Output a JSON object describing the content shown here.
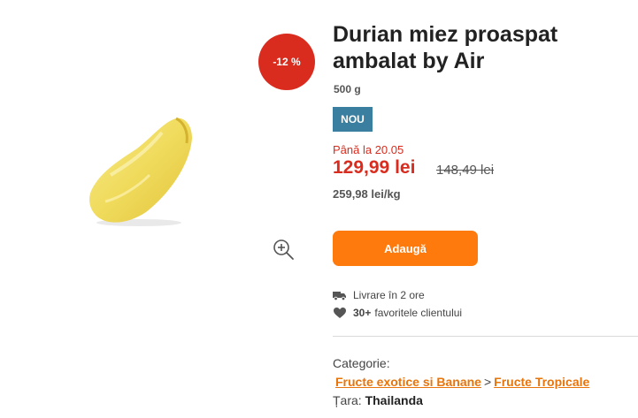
{
  "product": {
    "title": "Durian miez proaspat ambalat by Air",
    "weight": "500 g",
    "discount_badge": "-12 %",
    "new_badge": "NOU",
    "promo_until": "Până la 20.05",
    "price": "129,99 lei",
    "old_price": "148,49 lei",
    "unit_price": "259,98 lei/kg",
    "add_button_label": "Adaugă"
  },
  "features": {
    "delivery": "Livrare în 2 ore",
    "favorites_count": "30+",
    "favorites_text": "favoritele clientului"
  },
  "details": {
    "category_label": "Categorie:",
    "category_path": [
      "Fructe exotice si Banane",
      "Fructe Tropicale"
    ],
    "category_separator": ">",
    "country_label": "Țara:",
    "country_value": "Thailanda"
  },
  "icons": {
    "zoom": "zoom-in-icon",
    "delivery": "truck-icon",
    "favorites": "heart-icon"
  },
  "colors": {
    "discount": "#d92c1e",
    "new_badge": "#3a7fa0",
    "price": "#d92c1e",
    "add_button": "#ff7a0d",
    "link": "#e8740c"
  }
}
